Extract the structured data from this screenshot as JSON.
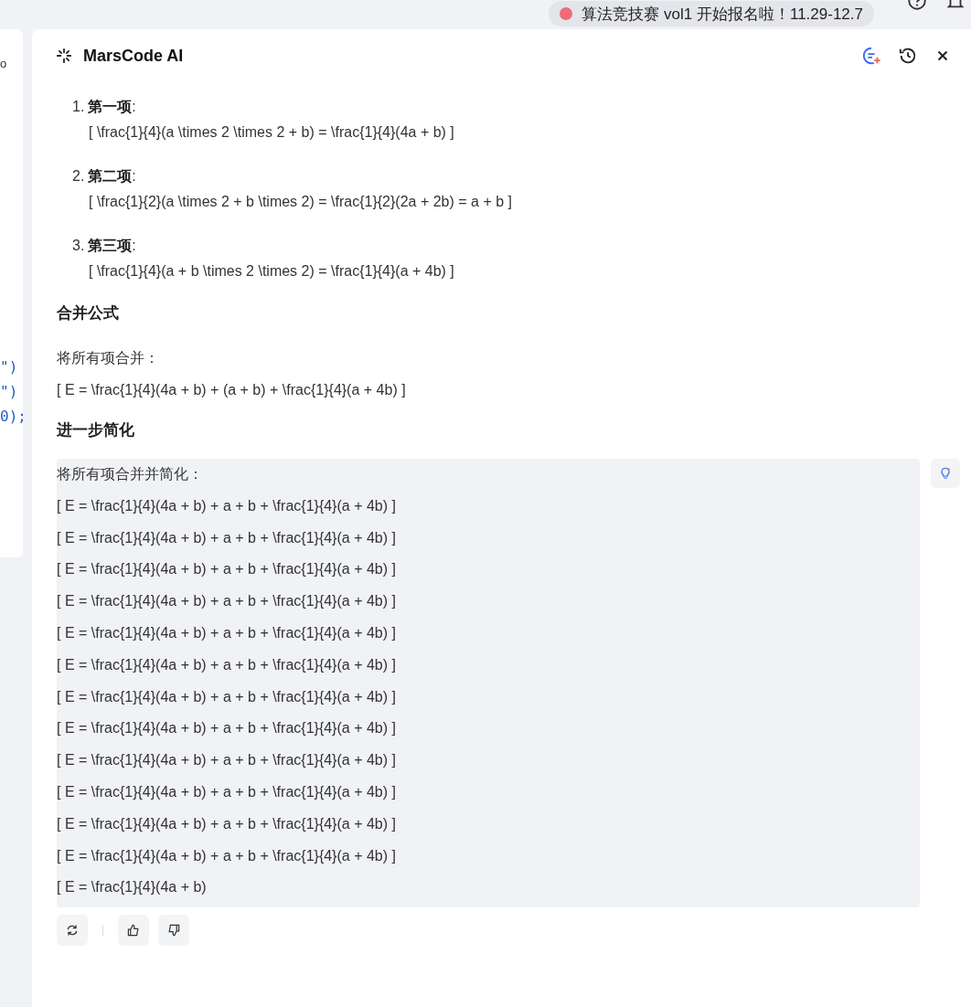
{
  "top_bar": {
    "banner": "算法竞技赛 vol1 开始报名啦！11.29-12.7"
  },
  "editor": {
    "lines": [
      {
        "text": "o"
      },
      {
        "text": "\")"
      },
      {
        "text": "\")"
      },
      {
        "text": "0);"
      }
    ]
  },
  "panel": {
    "title": "MarsCode AI"
  },
  "terms": [
    {
      "number": "1.",
      "label": "第一项",
      "colon": ":",
      "formula": "[ \\frac{1}{4}(a \\times 2 \\times 2 + b) = \\frac{1}{4}(4a + b) ]"
    },
    {
      "number": "2.",
      "label": "第二项",
      "colon": ":",
      "formula": "[ \\frac{1}{2}(a \\times 2 + b \\times 2) = \\frac{1}{2}(2a + 2b) = a + b ]"
    },
    {
      "number": "3.",
      "label": "第三项",
      "colon": ":",
      "formula": "[ \\frac{1}{4}(a + b \\times 2 \\times 2) = \\frac{1}{4}(a + 4b) ]"
    }
  ],
  "merge": {
    "heading": "合并公式",
    "intro": "将所有项合并：",
    "formula": "[ E = \\frac{1}{4}(4a + b) + (a + b) + \\frac{1}{4}(a + 4b) ]"
  },
  "simplify": {
    "heading": "进一步简化",
    "block_lines": [
      "将所有项合并并简化：",
      "[ E = \\frac{1}{4}(4a + b) + a + b + \\frac{1}{4}(a + 4b) ]",
      "[ E = \\frac{1}{4}(4a + b) + a + b + \\frac{1}{4}(a + 4b) ]",
      "[ E = \\frac{1}{4}(4a + b) + a + b + \\frac{1}{4}(a + 4b) ]",
      "[ E = \\frac{1}{4}(4a + b) + a + b + \\frac{1}{4}(a + 4b) ]",
      "[ E = \\frac{1}{4}(4a + b) + a + b + \\frac{1}{4}(a + 4b) ]",
      "[ E = \\frac{1}{4}(4a + b) + a + b + \\frac{1}{4}(a + 4b) ]",
      "[ E = \\frac{1}{4}(4a + b) + a + b + \\frac{1}{4}(a + 4b) ]",
      "[ E = \\frac{1}{4}(4a + b) + a + b + \\frac{1}{4}(a + 4b) ]",
      "[ E = \\frac{1}{4}(4a + b) + a + b + \\frac{1}{4}(a + 4b) ]",
      "[ E = \\frac{1}{4}(4a + b) + a + b + \\frac{1}{4}(a + 4b) ]",
      "[ E = \\frac{1}{4}(4a + b) + a + b + \\frac{1}{4}(a + 4b) ]",
      "[ E = \\frac{1}{4}(4a + b) + a + b + \\frac{1}{4}(a + 4b) ]",
      "[ E = \\frac{1}{4}(4a + b)"
    ]
  }
}
